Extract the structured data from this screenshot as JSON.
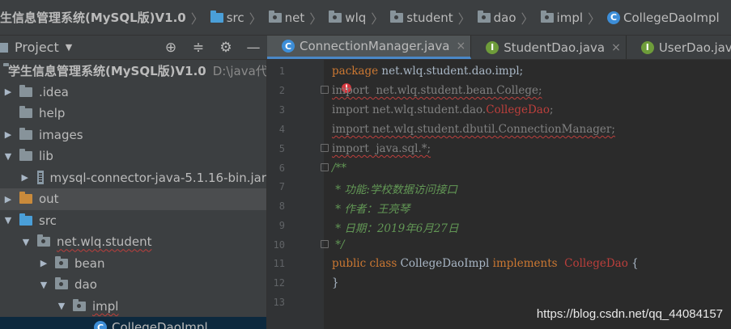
{
  "breadcrumb": {
    "project": "生信息管理系统(MySQL版)V1.0",
    "items": [
      "src",
      "net",
      "wlq",
      "student",
      "dao",
      "impl"
    ],
    "file": "CollegeDaoImpl"
  },
  "project_panel": {
    "title": "Project",
    "tools": [
      "target-icon",
      "collapse-icon",
      "gear-icon",
      "minimize-icon"
    ]
  },
  "tabs": [
    {
      "label": "ConnectionManager.java",
      "icon": "class-icon",
      "close": "×"
    },
    {
      "label": "StudentDao.java",
      "icon": "interface-icon",
      "close": "×"
    },
    {
      "label": "UserDao.java",
      "icon": "interface-icon",
      "close": "×"
    }
  ],
  "tree": {
    "root_label": "学生信息管理系统(MySQL版)V1.0",
    "root_path": "D:\\java代",
    "idea": ".idea",
    "help": "help",
    "images": "images",
    "lib": "lib",
    "jar": "mysql-connector-java-5.1.16-bin.jar",
    "out": "out",
    "src": "src",
    "pkg": "net.wlq.student",
    "bean": "bean",
    "dao": "dao",
    "impl": "impl",
    "file": "CollegeDaoImpl"
  },
  "editor": {
    "line_numbers": [
      "1",
      "2",
      "3",
      "4",
      "5",
      "6",
      "7",
      "8",
      "9",
      "10",
      "11",
      "12",
      "13"
    ],
    "code": {
      "l1_kw": "package",
      "l1_rest": " net.wlq.student.dao.impl;",
      "l2": "import  net.wlq.student.bean.College;",
      "l3_a": "import net.wlq.student.dao.",
      "l3_b": "CollegeDao",
      "l3_c": ";",
      "l4": "import net.wlq.student.dbutil.ConnectionManager;",
      "l5": "import  java.sql.*;",
      "l6": "/**",
      "l7": " * 功能:学校数据访问接口",
      "l8": " * 作者：王亮琴",
      "l9": " * 日期：2019年6月27日",
      "l10": " */",
      "l11_kw1": "public class",
      "l11_name": " CollegeDaoImpl ",
      "l11_kw2": "implements",
      "l11_iface": "  CollegeDao",
      "l11_brace": " {",
      "l12": "}"
    }
  },
  "watermark": "https://blog.csdn.net/qq_44084157"
}
